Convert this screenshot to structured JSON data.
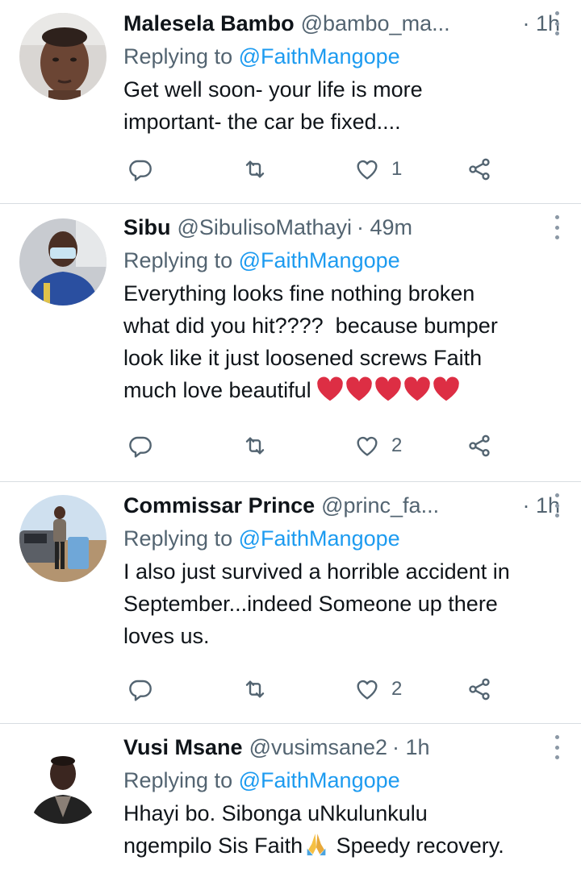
{
  "reply_prefix": "Replying to",
  "tweets": [
    {
      "name": "Malesela Bambo",
      "handle": "@bambo_ma...",
      "time": "· 1h",
      "reply_to": "@FaithMangope",
      "text": "Get well soon- your life is more\nimportant- the car be fixed....",
      "likes": "1"
    },
    {
      "name": "Sibu",
      "handle": "@SibulisoMathayi",
      "time": "· 49m",
      "reply_to": "@FaithMangope",
      "text": "Everything looks fine nothing broken\nwhat did you hit????  because bumper\nlook like it just loosened screws Faith\nmuch love beautiful",
      "emoji": "❤❤❤❤❤",
      "likes": "2"
    },
    {
      "name": "Commissar Prince",
      "handle": "@princ_fa...",
      "time": "· 1h",
      "reply_to": "@FaithMangope",
      "text": "I also just survived a horrible accident in\nSeptember...indeed Someone up there\nloves us.",
      "likes": "2"
    },
    {
      "name": "Vusi Msane",
      "handle": "@vusimsane2",
      "time": "· 1h",
      "reply_to": "@FaithMangope",
      "text_line1": "Hhayi bo. Sibonga uNkulunkulu",
      "text_line2_a": "ngempilo Sis Faith",
      "emoji": "🙏",
      "text_line2_b": " Speedy recovery."
    }
  ],
  "icons": {
    "reply": "reply-icon",
    "retweet": "retweet-icon",
    "like": "heart-icon",
    "share": "share-icon",
    "more": "more-options-icon"
  },
  "colors": {
    "accent": "#1d9bf0",
    "secondary_text": "#536471",
    "heart_emoji": "#dd2e44"
  }
}
